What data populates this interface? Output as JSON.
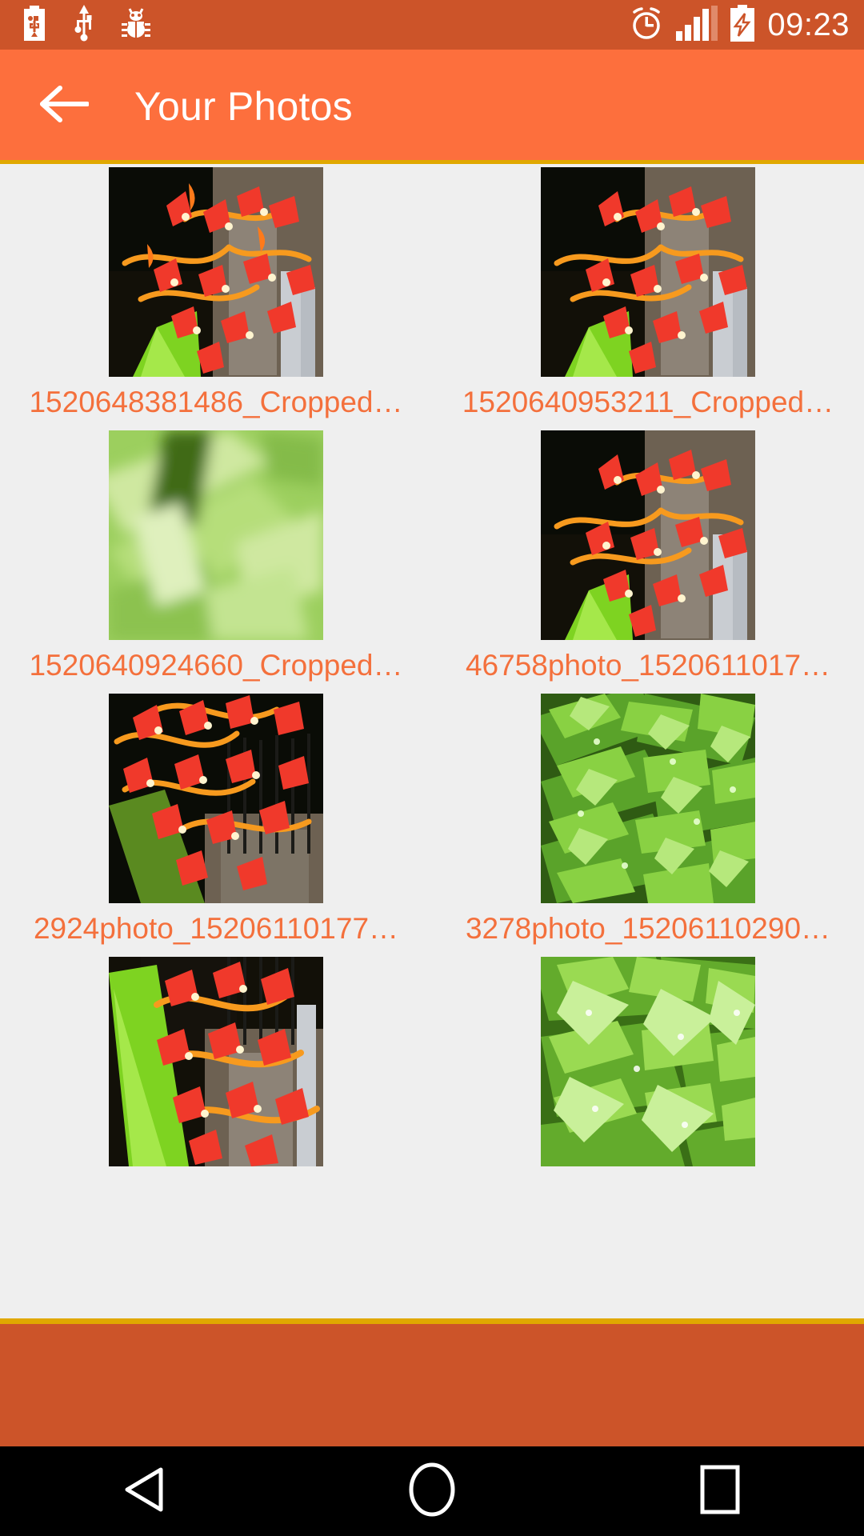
{
  "statusbar": {
    "background": "#cc5429",
    "time": "09:23",
    "icons": [
      {
        "name": "usb-battery-icon"
      },
      {
        "name": "usb-icon"
      },
      {
        "name": "bug-icon"
      },
      {
        "name": "alarm-clock-icon"
      },
      {
        "name": "signal-bars-icon"
      },
      {
        "name": "battery-charging-icon"
      }
    ]
  },
  "appbar": {
    "background": "#fd6f3d",
    "underline_color": "#e0a800",
    "back_icon": "arrow-left-icon",
    "title": "Your Photos"
  },
  "gallery": {
    "background": "#efefef",
    "caption_color": "#f4703c",
    "columns": 2,
    "items": [
      {
        "caption": "1520648381486_Cropped…",
        "thumb": "flowers-gate"
      },
      {
        "caption": "1520640953211_Cropped…",
        "thumb": "flowers-gate"
      },
      {
        "caption": "1520640924660_Cropped…",
        "thumb": "green-blur"
      },
      {
        "caption": "46758photo_1520611017…",
        "thumb": "flowers-gate"
      },
      {
        "caption": "2924photo_15206110177…",
        "thumb": "flowers-gate"
      },
      {
        "caption": "3278photo_15206110290…",
        "thumb": "green-leaves"
      },
      {
        "caption": "",
        "thumb": "flowers-gate"
      },
      {
        "caption": "",
        "thumb": "green-blur"
      }
    ]
  },
  "bottom": {
    "divider_color": "#e0a800",
    "bar_color": "#cc5429"
  },
  "navbar": {
    "background": "#000000",
    "buttons": [
      {
        "name": "nav-back-button",
        "icon": "triangle-left-icon"
      },
      {
        "name": "nav-home-button",
        "icon": "circle-icon"
      },
      {
        "name": "nav-recents-button",
        "icon": "square-icon"
      }
    ]
  }
}
